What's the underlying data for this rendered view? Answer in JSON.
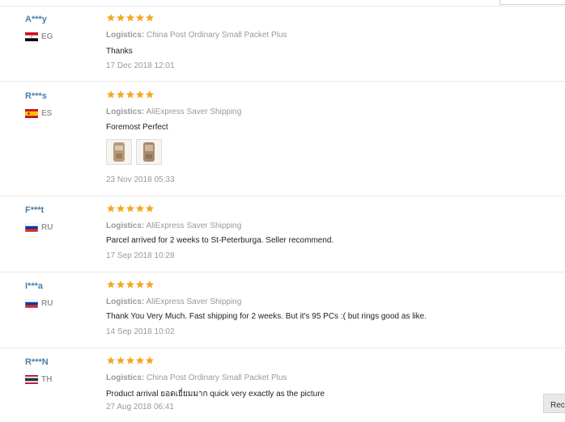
{
  "colors": {
    "username": "#4a7fa8",
    "star": "#f5a623",
    "muted": "#999999",
    "divider": "#e8e8e8"
  },
  "logistics_label": "Logistics:",
  "reviews": [
    {
      "user": "A***y",
      "country": "EG",
      "flag": "egypt-flag-icon",
      "rating": 5,
      "logistics": "China Post Ordinary Small Packet Plus",
      "text": "Thanks",
      "date": "17 Dec 2018 12:01"
    },
    {
      "user": "R***s",
      "country": "ES",
      "flag": "spain-flag-icon",
      "rating": 5,
      "logistics": "AliExpress Saver Shipping",
      "text": "Foremost Perfect",
      "photos": 2,
      "date": "23 Nov 2018 05:33"
    },
    {
      "user": "F***t",
      "country": "RU",
      "flag": "russia-flag-icon",
      "rating": 5,
      "logistics": "AliExpress Saver Shipping",
      "text": "Parcel arrived for 2 weeks to St-Peterburga. Seller recommend.",
      "date": "17 Sep 2018 10:28"
    },
    {
      "user": "I***a",
      "country": "RU",
      "flag": "russia-flag-icon",
      "rating": 5,
      "logistics": "AliExpress Saver Shipping",
      "text": "Thank You Very Much. Fast shipping for 2 weeks. But it's 95 PCs :( but rings good as like.",
      "date": "14 Sep 2018 10:02"
    },
    {
      "user": "R***N",
      "country": "TH",
      "flag": "thailand-flag-icon",
      "rating": 5,
      "logistics": "China Post Ordinary Small Packet Plus",
      "text": "Product arrival ยอดเยี่ยมมาก quick very exactly as the picture",
      "date": "27 Aug 2018 06:41"
    }
  ],
  "corner_button": "Rec"
}
